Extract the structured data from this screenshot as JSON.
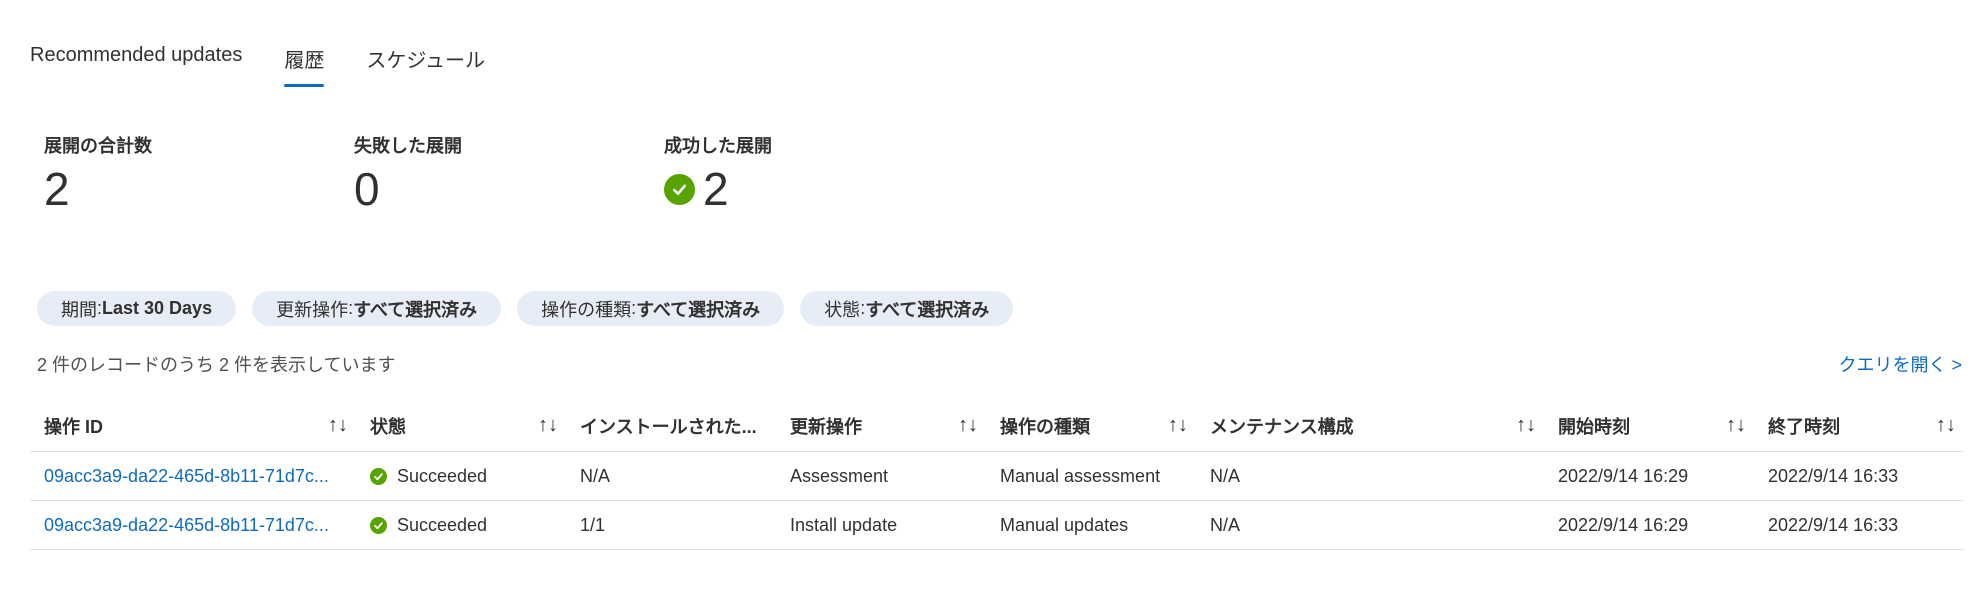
{
  "tabs": [
    {
      "label": "Recommended updates"
    },
    {
      "label": "履歴",
      "active": true
    },
    {
      "label": "スケジュール"
    }
  ],
  "stats": [
    {
      "label": "展開の合計数",
      "value": "2"
    },
    {
      "label": "失敗した展開",
      "value": "0"
    },
    {
      "label": "成功した展開",
      "value": "2",
      "icon": "success-check-icon"
    }
  ],
  "filters": [
    {
      "key": "期間",
      "value": "Last 30 Days"
    },
    {
      "key": "更新操作",
      "value": "すべて選択済み"
    },
    {
      "key": "操作の種類",
      "value": "すべて選択済み"
    },
    {
      "key": "状態",
      "value": "すべて選択済み"
    }
  ],
  "record_count": "2 件のレコードのうち 2 件を表示しています",
  "open_query": "クエリを開く >",
  "sort_glyph": "↑↓",
  "filter_separator": " : ",
  "table": {
    "columns": [
      "操作 ID",
      "状態",
      "インストールされた...",
      "更新操作",
      "操作の種類",
      "メンテナンス構成",
      "開始時刻",
      "終了時刻"
    ],
    "rows": [
      [
        "09acc3a9-da22-465d-8b11-71d7c...",
        "Succeeded",
        "N/A",
        "Assessment",
        "Manual assessment",
        "N/A",
        "2022/9/14 16:29",
        "2022/9/14 16:33"
      ],
      [
        "09acc3a9-da22-465d-8b11-71d7c...",
        "Succeeded",
        "1/1",
        "Install update",
        "Manual updates",
        "N/A",
        "2022/9/14 16:29",
        "2022/9/14 16:33"
      ]
    ]
  },
  "colors": {
    "accent": "#0f6cbd",
    "success": "#57a300",
    "pill_bg": "#e7edf7"
  }
}
